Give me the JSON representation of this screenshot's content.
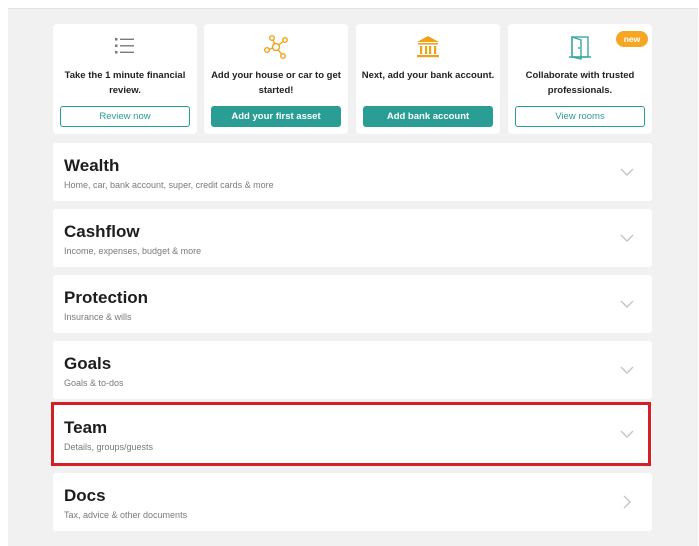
{
  "cards": [
    {
      "id": "review",
      "text": "Take the 1 minute financial review.",
      "button": "Review now",
      "icon": "list-icon",
      "style": "outline"
    },
    {
      "id": "asset",
      "text": "Add your house or car to get started!",
      "button": "Add your first asset",
      "icon": "network-icon",
      "style": "solid"
    },
    {
      "id": "bank",
      "text": "Next, add your bank account.",
      "button": "Add bank account",
      "icon": "bank-icon",
      "style": "solid"
    },
    {
      "id": "rooms",
      "text": "Collaborate with trusted professionals.",
      "button": "View rooms",
      "icon": "door-icon",
      "style": "outline",
      "badge": "new"
    }
  ],
  "sections": [
    {
      "id": "wealth",
      "title": "Wealth",
      "subtitle": "Home, car, bank account, super, credit cards & more",
      "chevron": "down"
    },
    {
      "id": "cashflow",
      "title": "Cashflow",
      "subtitle": "Income, expenses, budget & more",
      "chevron": "down"
    },
    {
      "id": "protection",
      "title": "Protection",
      "subtitle": "Insurance & wills",
      "chevron": "down"
    },
    {
      "id": "goals",
      "title": "Goals",
      "subtitle": "Goals & to-dos",
      "chevron": "down"
    },
    {
      "id": "team",
      "title": "Team",
      "subtitle": "Details, groups/guests",
      "chevron": "down",
      "highlighted": true
    },
    {
      "id": "docs",
      "title": "Docs",
      "subtitle": "Tax, advice & other documents",
      "chevron": "right"
    }
  ],
  "colors": {
    "accent": "#2a9d94",
    "badge": "#f5a623",
    "highlight": "#d51f26",
    "icon": "#3aa9a0",
    "bank_icon": "#f0a21a"
  }
}
